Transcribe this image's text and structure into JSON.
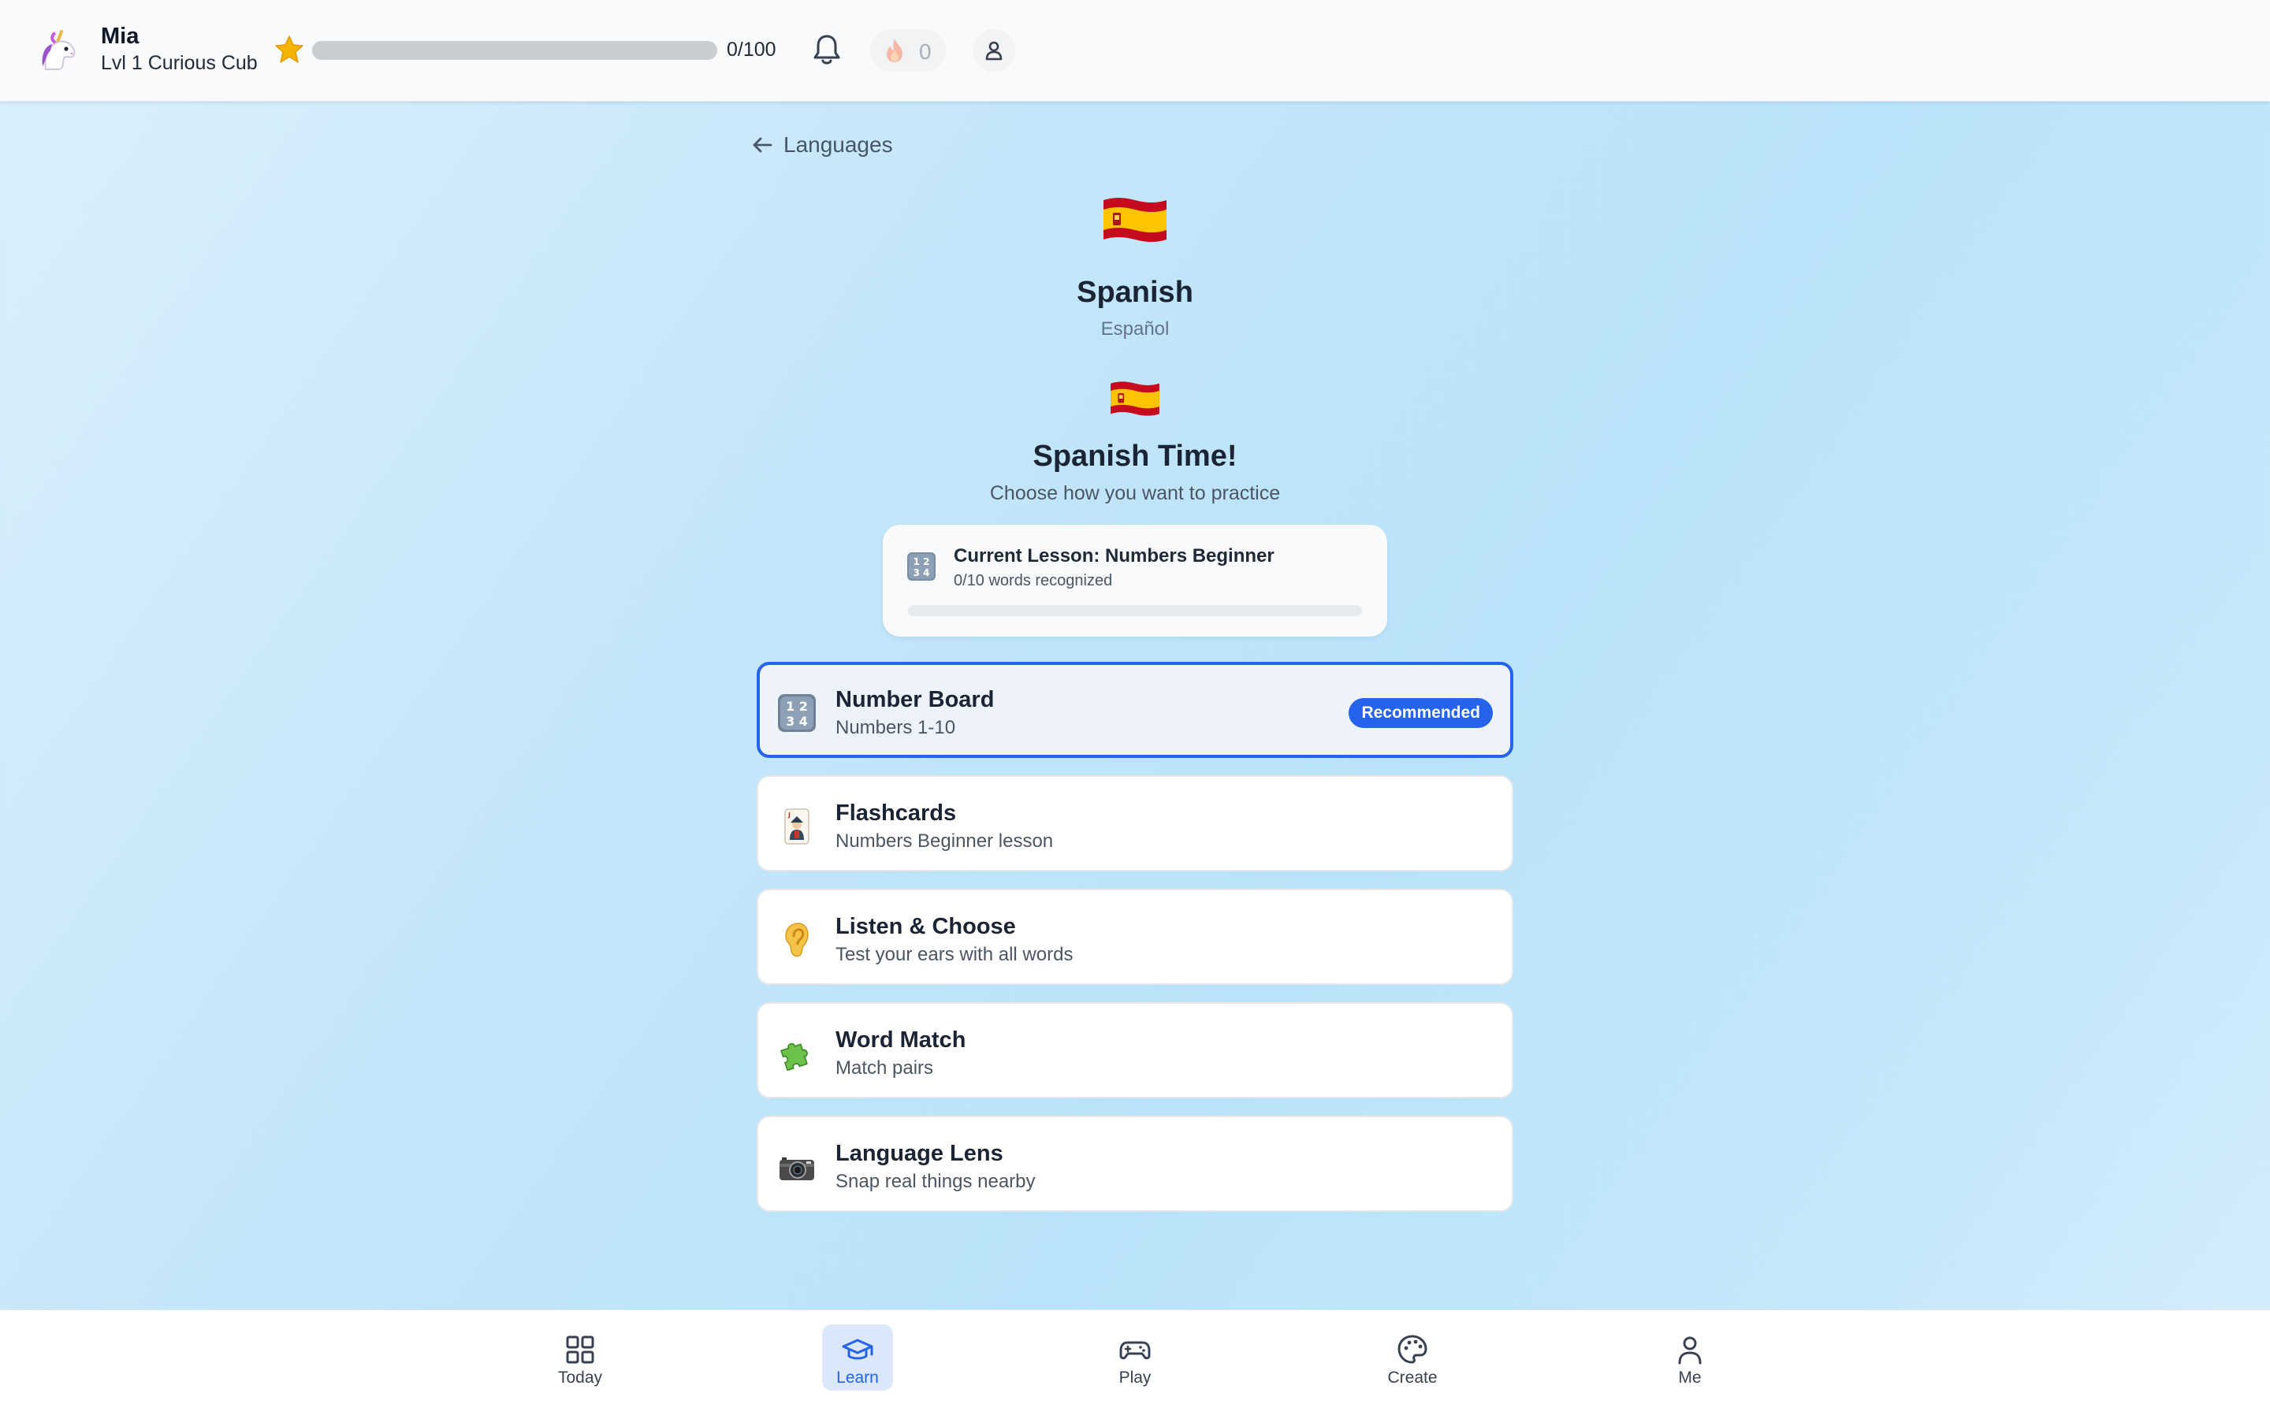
{
  "header": {
    "user_name": "Mia",
    "user_level": "Lvl 1 Curious Cub",
    "xp_text": "0/100",
    "xp_progress": 0,
    "streak_count": "0",
    "icons": {
      "avatar": "unicorn-icon",
      "star": "star-icon",
      "notifications": "bell-icon",
      "streak": "flame-icon",
      "profile": "person-icon"
    }
  },
  "main": {
    "back_label": "Languages",
    "language_name": "Spanish",
    "language_native": "Español",
    "headline": "Spanish Time!",
    "subheadline": "Choose how you want to practice",
    "current_lesson": {
      "title": "Current Lesson: Numbers Beginner",
      "subtitle": "0/10 words recognized",
      "progress": 0
    },
    "options": [
      {
        "title": "Number Board",
        "subtitle": "Numbers 1-10",
        "badge": "Recommended",
        "icon": "numbers-icon",
        "selected": true
      },
      {
        "title": "Flashcards",
        "subtitle": "Numbers Beginner lesson",
        "icon": "playing-card-icon"
      },
      {
        "title": "Listen & Choose",
        "subtitle": "Test your ears with all words",
        "icon": "ear-icon"
      },
      {
        "title": "Word Match",
        "subtitle": "Match pairs",
        "icon": "puzzle-icon"
      },
      {
        "title": "Language Lens",
        "subtitle": "Snap real things nearby",
        "icon": "camera-icon"
      }
    ]
  },
  "nav": {
    "items": [
      {
        "label": "Today",
        "icon": "grid-icon"
      },
      {
        "label": "Learn",
        "icon": "graduation-cap-icon",
        "active": true
      },
      {
        "label": "Play",
        "icon": "gamepad-icon"
      },
      {
        "label": "Create",
        "icon": "palette-icon"
      },
      {
        "label": "Me",
        "icon": "person-icon"
      }
    ]
  },
  "colors": {
    "accent": "#2563eb",
    "background": "#c4e6fa",
    "star": "#f5b400",
    "flag_red": "#c60b1e",
    "flag_yellow": "#ffc400"
  }
}
